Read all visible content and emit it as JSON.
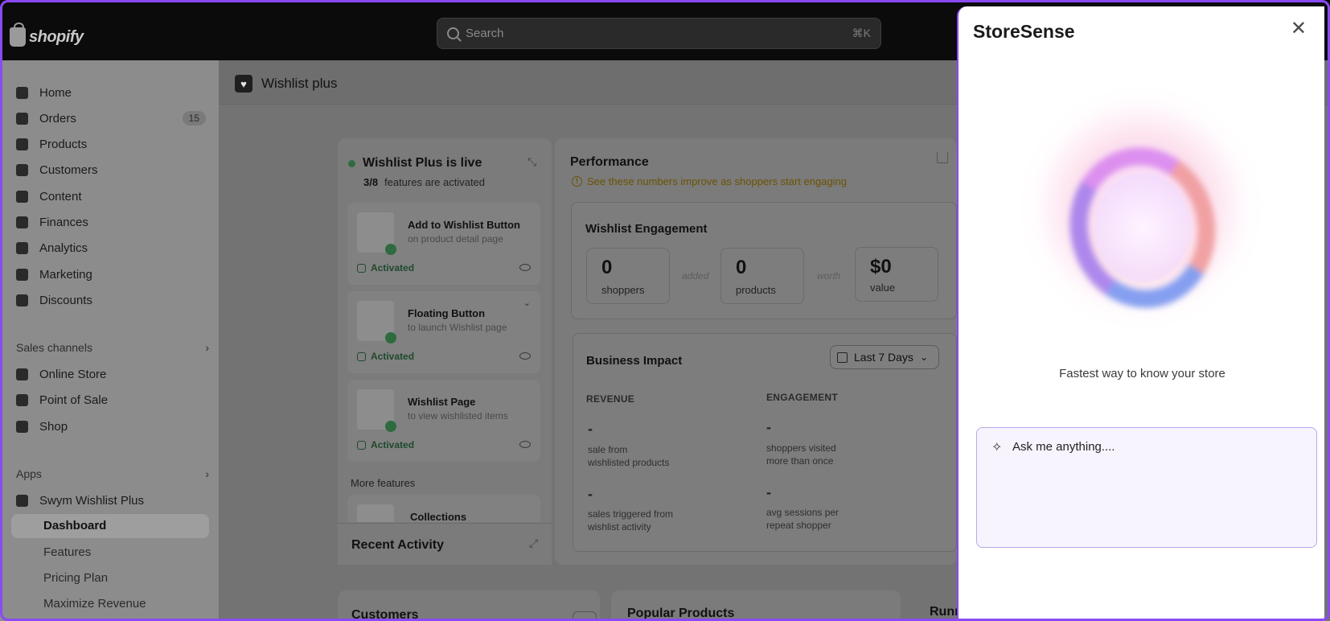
{
  "topbar": {
    "logo_text": "shopify",
    "search_placeholder": "Search",
    "search_shortcut": "⌘K"
  },
  "sidebar": {
    "items": [
      {
        "label": "Home",
        "icon": "home-icon"
      },
      {
        "label": "Orders",
        "icon": "orders-icon",
        "badge": "15"
      },
      {
        "label": "Products",
        "icon": "tag-icon"
      },
      {
        "label": "Customers",
        "icon": "person-icon"
      },
      {
        "label": "Content",
        "icon": "content-icon"
      },
      {
        "label": "Finances",
        "icon": "bank-icon"
      },
      {
        "label": "Analytics",
        "icon": "chart-icon"
      },
      {
        "label": "Marketing",
        "icon": "target-icon"
      },
      {
        "label": "Discounts",
        "icon": "discount-icon"
      }
    ],
    "sales_channels_heading": "Sales channels",
    "sales_channels": [
      {
        "label": "Online Store",
        "icon": "store-icon"
      },
      {
        "label": "Point of Sale",
        "icon": "pos-icon"
      },
      {
        "label": "Shop",
        "icon": "shop-icon"
      }
    ],
    "apps_heading": "Apps",
    "app_name": "Swym Wishlist Plus",
    "app_subitems": [
      "Dashboard",
      "Features",
      "Pricing Plan",
      "Maximize Revenue"
    ]
  },
  "page": {
    "title": "Wishlist plus"
  },
  "status_card": {
    "title": "Wishlist Plus is live",
    "count": "3/8",
    "count_suffix": "features are activated",
    "features": [
      {
        "title": "Add to Wishlist Button",
        "subtitle": "on product detail page",
        "status": "Activated"
      },
      {
        "title": "Floating Button",
        "subtitle": "to launch Wishlist page",
        "status": "Activated"
      },
      {
        "title": "Wishlist Page",
        "subtitle": "to view wishlisted items",
        "status": "Activated"
      }
    ],
    "more_features_label": "More features",
    "next_feature": "Collections"
  },
  "recent_activity": {
    "title": "Recent Activity"
  },
  "performance": {
    "title": "Performance",
    "notice": "See these numbers improve as shoppers start engaging",
    "engagement_title": "Wishlist Engagement",
    "metrics": [
      {
        "value": "0",
        "label": "shoppers"
      },
      {
        "value": "0",
        "label": "products"
      },
      {
        "value": "$0",
        "label": "value"
      }
    ],
    "connectors": [
      "added",
      "worth"
    ],
    "impact_title": "Business Impact",
    "date_range": "Last 7 Days",
    "revenue_heading": "REVENUE",
    "engagement_heading": "ENGAGEMENT",
    "revenue_stats": [
      {
        "value": "-",
        "line1": "sale from",
        "line2": "wishlisted products"
      },
      {
        "value": "-",
        "line1": "sales triggered from",
        "line2": "wishlist activity"
      }
    ],
    "engagement_stats": [
      {
        "value": "-",
        "line1": "shoppers visited",
        "line2": "more than once"
      },
      {
        "value": "-",
        "line1": "avg sessions per",
        "line2": "repeat shopper"
      }
    ]
  },
  "bottom_cards": {
    "customers": "Customers",
    "popular_products": "Popular Products",
    "running": "Runn"
  },
  "panel": {
    "title": "StoreSense",
    "tagline": "Fastest way to know your store",
    "input_placeholder": "Ask me anything....",
    "accent_color": "#8a4af3"
  }
}
